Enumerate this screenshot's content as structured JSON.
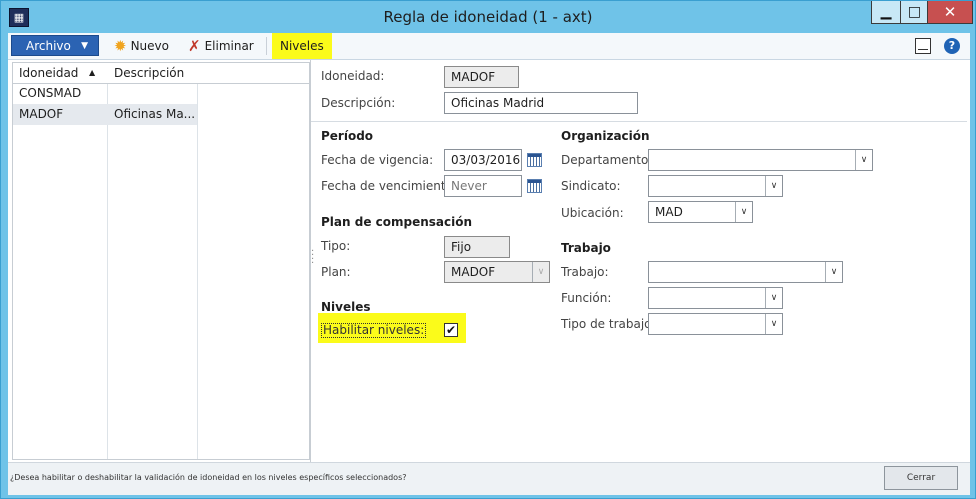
{
  "window": {
    "title": "Regla de idoneidad (1 - axt)",
    "minimize_glyph": "▁",
    "maximize_glyph": "□",
    "close_glyph": "✕"
  },
  "toolbar": {
    "archivo_label": "Archivo",
    "archivo_caret": "▼",
    "nuevo_label": "Nuevo",
    "nuevo_icon": "✹",
    "eliminar_label": "Eliminar",
    "eliminar_icon": "✗",
    "niveles_label": "Niveles",
    "help_glyph": "?",
    "highlight_color": "#fbfb1a"
  },
  "grid": {
    "columns": [
      "Idoneidad",
      "Descripción"
    ],
    "sort_glyph": "▲",
    "rows": [
      {
        "idoneidad": "CONSMAD",
        "descripcion": ""
      },
      {
        "idoneidad": "MADOF",
        "descripcion": "Oficinas Ma..."
      }
    ],
    "selected_row": 1
  },
  "form": {
    "idoneidad_label": "Idoneidad:",
    "idoneidad_value": "MADOF",
    "descripcion_label": "Descripción:",
    "descripcion_value": "Oficinas Madrid",
    "periodo": {
      "header": "Período",
      "vigencia_label": "Fecha de vigencia:",
      "vigencia_value": "03/03/2016",
      "vencimiento_label": "Fecha de vencimiento:",
      "vencimiento_placeholder": "Never"
    },
    "plan": {
      "header": "Plan de compensación",
      "tipo_label": "Tipo:",
      "tipo_value": "Fijo",
      "plan_label": "Plan:",
      "plan_value": "MADOF"
    },
    "niveles": {
      "header": "Niveles",
      "habilitar_label": "Habilitar niveles:",
      "habilitar_checked": true,
      "check_glyph": "✔"
    },
    "organizacion": {
      "header": "Organización",
      "departamento_label": "Departamento:",
      "departamento_value": "",
      "sindicato_label": "Sindicato:",
      "sindicato_value": "",
      "ubicacion_label": "Ubicación:",
      "ubicacion_value": "MAD"
    },
    "trabajo": {
      "header": "Trabajo",
      "trabajo_label": "Trabajo:",
      "trabajo_value": "",
      "funcion_label": "Función:",
      "funcion_value": "",
      "tipo_trabajo_label": "Tipo de trabajo:",
      "tipo_trabajo_value": ""
    },
    "dropdown_glyph": "∨"
  },
  "status": {
    "help_text": "¿Desea habilitar o deshabilitar la validación de idoneidad en los niveles específicos seleccionados?",
    "cerrar_label": "Cerrar"
  }
}
